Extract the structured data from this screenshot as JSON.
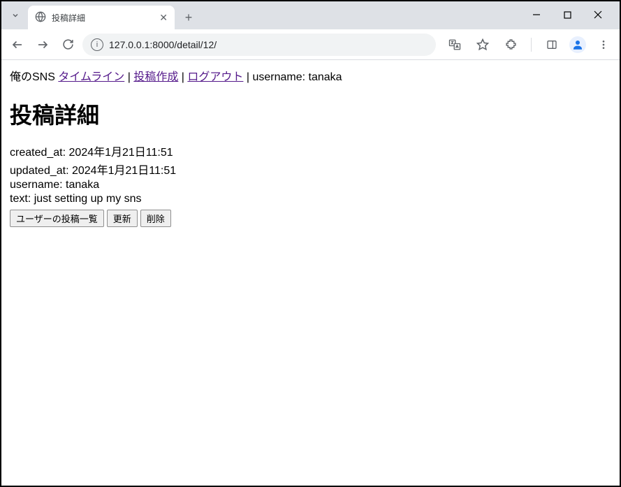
{
  "browser": {
    "tab_title": "投稿詳細",
    "url": "127.0.0.1:8000/detail/12/"
  },
  "nav": {
    "brand": "俺のSNS",
    "timeline": "タイムライン",
    "new_post": "投稿作成",
    "logout": "ログアウト",
    "username_label": "username:",
    "username": "tanaka",
    "sep": " | "
  },
  "page": {
    "heading": "投稿詳細",
    "created_label": "created_at:",
    "created_value": "2024年1月21日11:51",
    "updated_label": "updated_at:",
    "updated_value": "2024年1月21日11:51",
    "username_label": "username:",
    "username_value": "tanaka",
    "text_label": "text:",
    "text_value": "just setting up my sns"
  },
  "buttons": {
    "user_posts": "ユーザーの投稿一覧",
    "update": "更新",
    "delete": "削除"
  }
}
